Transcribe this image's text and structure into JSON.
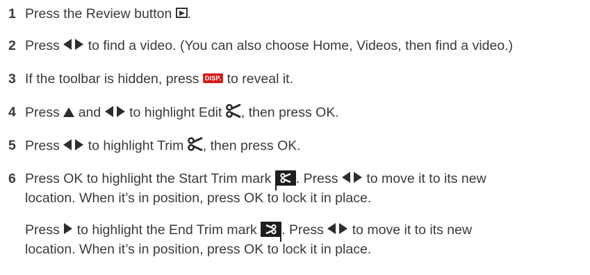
{
  "steps": [
    {
      "num": "1",
      "t1": "Press the Review button",
      "t2": "."
    },
    {
      "num": "2",
      "t1": "Press",
      "t2": "to find a video. (You can also choose Home, Videos, then find a video.)"
    },
    {
      "num": "3",
      "t1": "If the toolbar is hidden, press",
      "badge": "DISP.",
      "t2": "to reveal it."
    },
    {
      "num": "4",
      "t1": "Press",
      "t2": "and",
      "t3": "to highlight Edit",
      "t4": ", then press OK."
    },
    {
      "num": "5",
      "t1": "Press",
      "t2": "to highlight Trim",
      "t3": ", then press OK."
    },
    {
      "num": "6",
      "l1a": "Press OK to highlight the Start Trim mark",
      "l1b": ". Press",
      "l1c": "to move it to its new",
      "l2": "location. When it’s in position, press OK to lock it in place."
    }
  ],
  "end_trim": {
    "l1a": "Press",
    "l1b": "to highlight the End Trim mark",
    "l1c": ". Press",
    "l1d": "to move it to its new",
    "l2": "location. When it’s in position, press OK to lock it in place."
  },
  "icons": {
    "review": "review-play-icon",
    "left_right": "left-right-arrows-icon",
    "up": "up-arrow-icon",
    "right": "right-arrow-icon",
    "scissors": "scissors-icon",
    "start_trim": "start-trim-mark-icon",
    "end_trim": "end-trim-mark-icon"
  },
  "colors": {
    "text": "#3a3a3a",
    "disp_badge": "#d31c1c",
    "trim_mark": "#1e1e1e"
  }
}
